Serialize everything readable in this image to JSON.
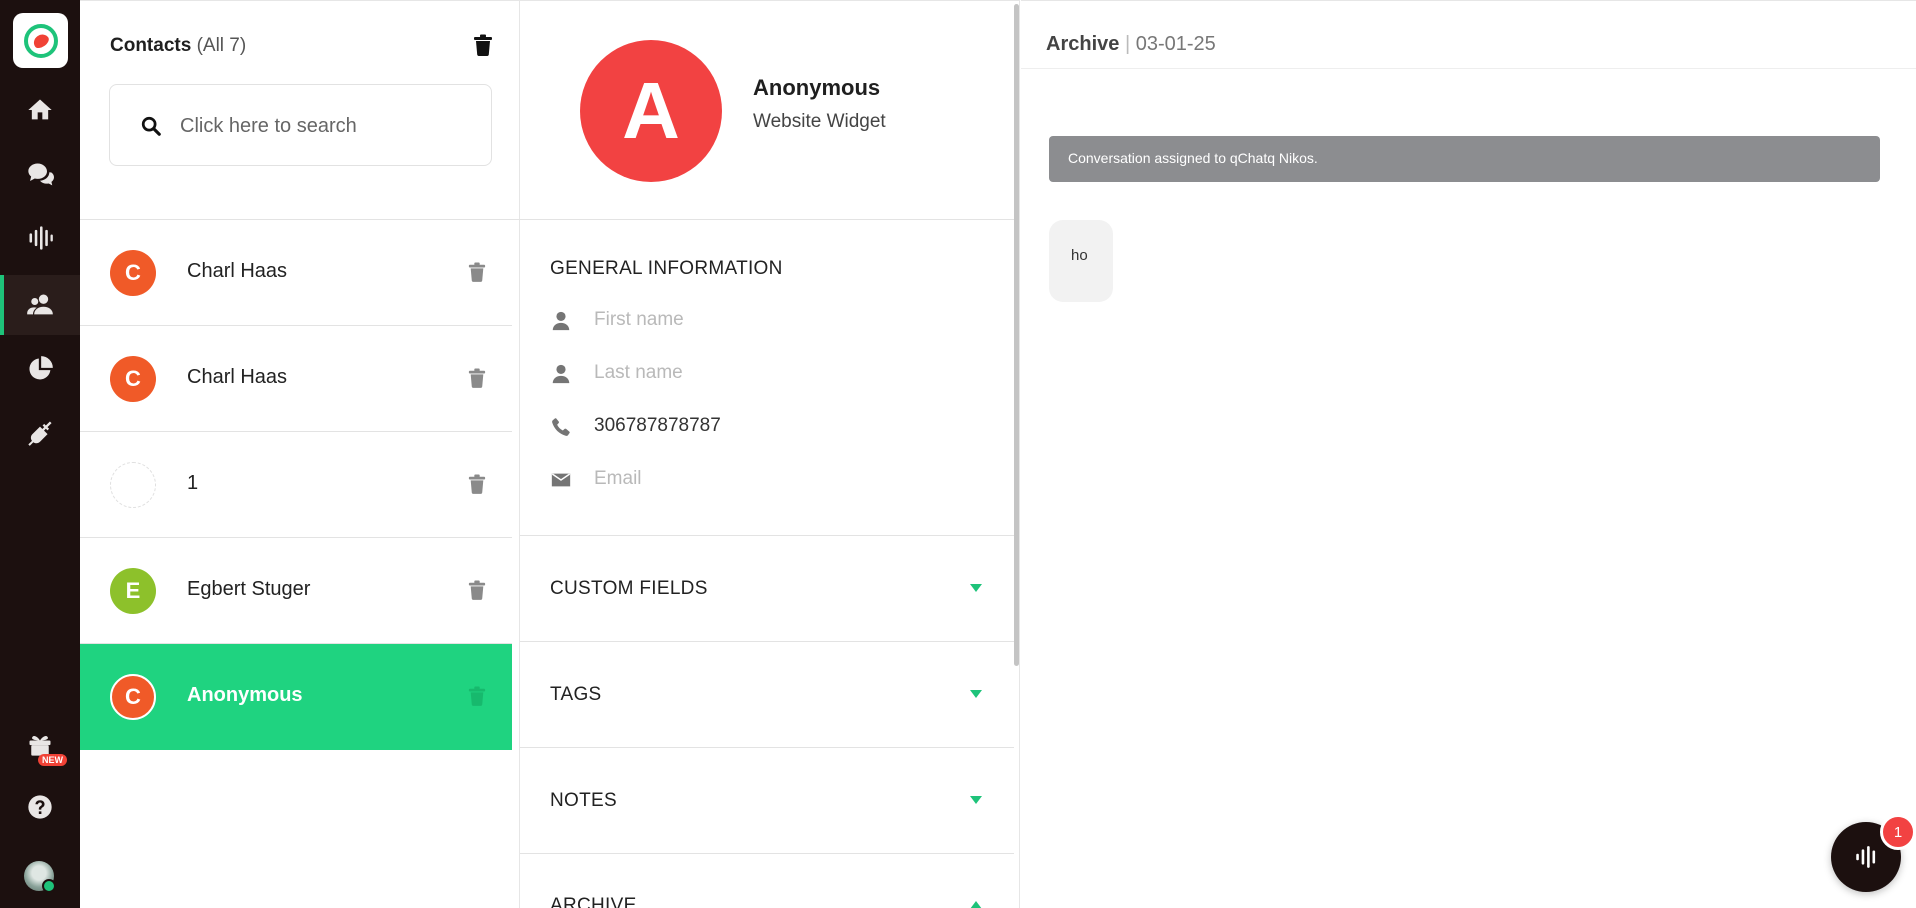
{
  "nav": {
    "brand_color": "#1ec37a",
    "items": [
      {
        "icon": "home-icon"
      },
      {
        "icon": "chat-bubbles-icon"
      },
      {
        "icon": "audio-bars-icon"
      },
      {
        "icon": "contacts-icon",
        "active": true
      },
      {
        "icon": "pie-chart-icon"
      },
      {
        "icon": "plug-icon"
      }
    ],
    "gift_badge": "NEW"
  },
  "contacts": {
    "title": "Contacts",
    "count": "(All 7)",
    "search_placeholder": "Click here to search",
    "list": [
      {
        "initial": "C",
        "name": "Charl Haas",
        "color": "#f05a28"
      },
      {
        "initial": "C",
        "name": "Charl Haas",
        "color": "#f05a28"
      },
      {
        "initial": "",
        "name": "1",
        "color": ""
      },
      {
        "initial": "E",
        "name": "Egbert Stuger",
        "color": "#8dc12b"
      },
      {
        "initial": "C",
        "name": "Anonymous",
        "color": "#f05a28",
        "active": true
      }
    ]
  },
  "detail": {
    "avatar_initial": "A",
    "name": "Anonymous",
    "source": "Website Widget",
    "general_title": "GENERAL INFORMATION",
    "fields": {
      "first_name": "First name",
      "last_name": "Last name",
      "phone": "306787878787",
      "email": "Email"
    },
    "sections": [
      "CUSTOM FIELDS",
      "TAGS",
      "NOTES",
      "ARCHIVE"
    ]
  },
  "chat": {
    "title": "Archive",
    "date": "03-01-25",
    "system_message": "Conversation assigned to qChatq Nikos.",
    "message": "ho",
    "unread_count": "1"
  }
}
